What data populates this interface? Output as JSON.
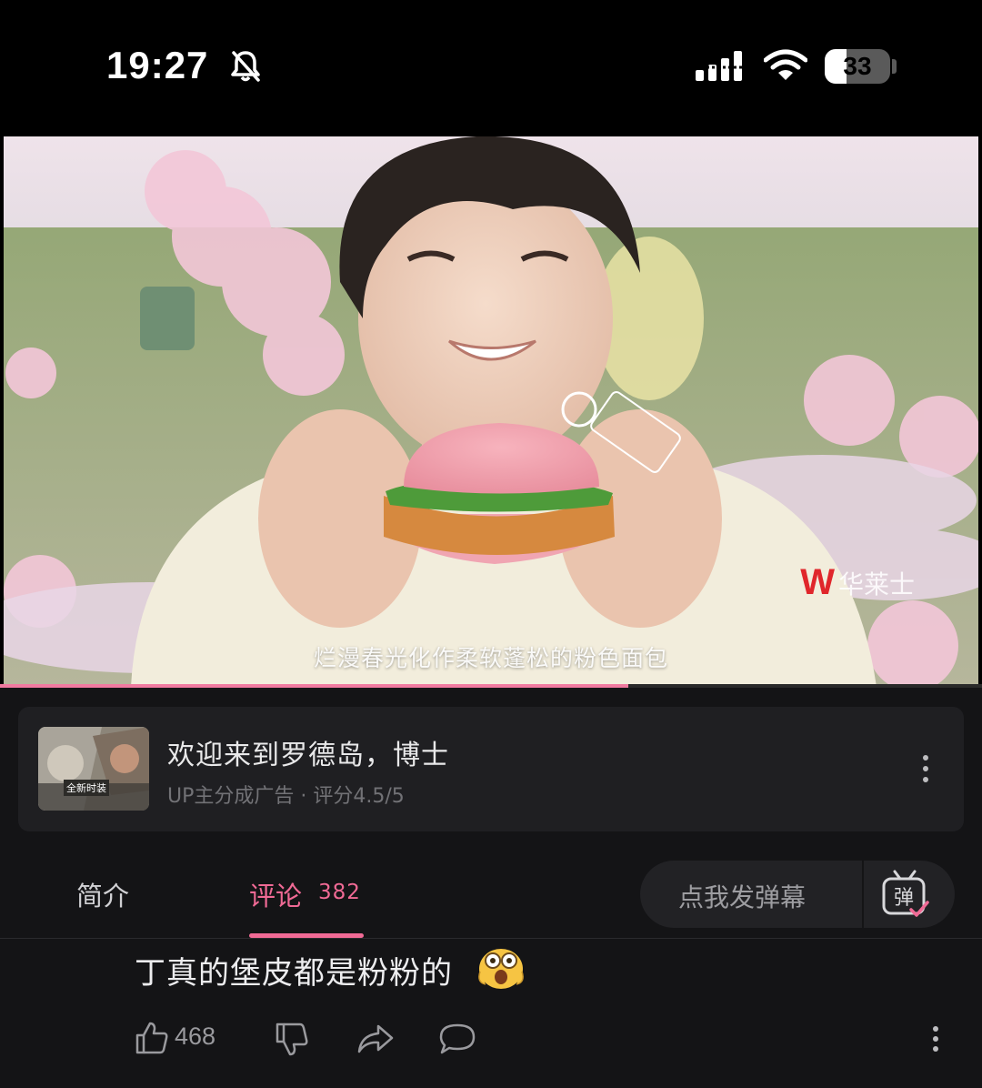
{
  "status_bar": {
    "time": "19:27",
    "battery_level": "33",
    "icons": [
      "bell-slash-icon",
      "cellular-signal-icon",
      "wifi-icon",
      "battery-icon"
    ]
  },
  "video": {
    "subtitle": "烂漫春光化作柔软蓬松的粉色面包",
    "watermark_brand": "华莱士",
    "watermark_logo": "W",
    "progress_fraction": 0.64
  },
  "ad": {
    "title": "欢迎来到罗德岛，博士",
    "meta": "UP主分成广告 · 评分4.5/5",
    "thumb_caption": "全新时装"
  },
  "tabs": {
    "intro_label": "简介",
    "comments_label": "评论",
    "comments_count": "382",
    "danmaku_placeholder": "点我发弹幕",
    "danmaku_icon_char": "弹"
  },
  "comment": {
    "text": "丁真的堡皮都是粉粉的",
    "emoji": "shocked-face-emoji",
    "likes": "468"
  },
  "colors": {
    "accent_pink": "#f06a95",
    "background": "#141416",
    "card": "#1f1f22"
  }
}
